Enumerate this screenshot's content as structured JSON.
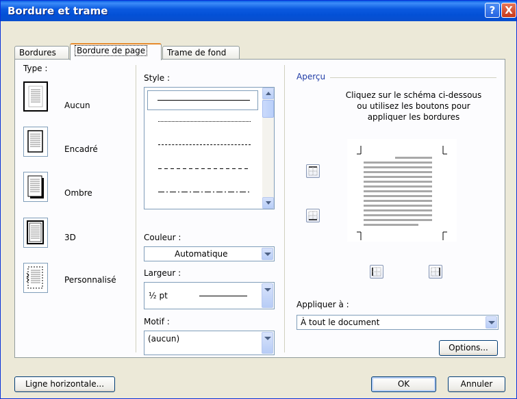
{
  "window": {
    "title": "Bordure et trame",
    "help_label": "?",
    "close_label": "X"
  },
  "tabs": [
    {
      "label": "Bordures"
    },
    {
      "label": "Bordure de page",
      "active": true
    },
    {
      "label": "Trame de fond"
    }
  ],
  "setting": {
    "label": "Type :",
    "items": [
      {
        "label": "Aucun",
        "selected": true
      },
      {
        "label": "Encadré"
      },
      {
        "label": "Ombre"
      },
      {
        "label": "3D"
      },
      {
        "label": "Personnalisé"
      }
    ]
  },
  "style": {
    "label": "Style :",
    "options": [
      "solid",
      "dotted",
      "dash-small",
      "dash",
      "dash-dot"
    ],
    "selected_index": 0
  },
  "color": {
    "label": "Couleur :",
    "value": "Automatique"
  },
  "width": {
    "label": "Largeur :",
    "value": "½ pt"
  },
  "art": {
    "label": "Motif :",
    "value": "(aucun)"
  },
  "preview": {
    "label": "Aperçu",
    "instruction_line1": "Cliquez sur le schéma ci-dessous",
    "instruction_line2": "ou utilisez les boutons pour",
    "instruction_line3": "appliquer les bordures"
  },
  "apply_to": {
    "label": "Appliquer à :",
    "value": "À tout le document"
  },
  "buttons": {
    "options": "Options...",
    "horizontal_line": "Ligne horizontale...",
    "ok": "OK",
    "cancel": "Annuler"
  },
  "colors": {
    "title_bar": "#0a5fe4",
    "dialog_bg": "#ece9d8",
    "accent_tab": "#e68b2c",
    "preview_label": "#1e3aa5"
  }
}
